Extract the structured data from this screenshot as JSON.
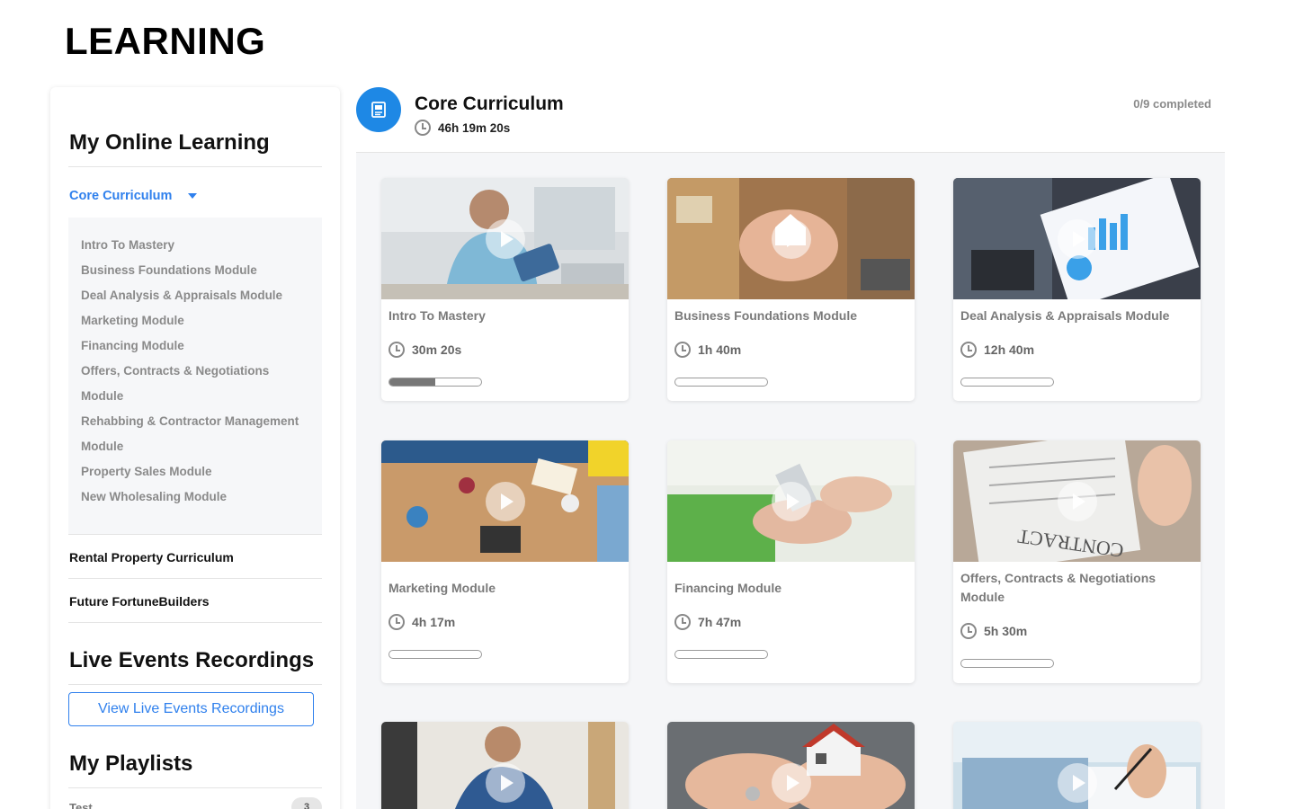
{
  "page": {
    "title": "LEARNING"
  },
  "sidebar": {
    "online_heading": "My Online Learning",
    "active_curriculum": "Core Curriculum",
    "modules": [
      "Intro To Mastery",
      "Business Foundations Module",
      "Deal Analysis & Appraisals Module",
      "Marketing Module",
      "Financing Module",
      "Offers, Contracts & Negotiations",
      "Module",
      "Rehabbing & Contractor Management",
      "Module",
      "Property Sales Module",
      "New Wholesaling Module"
    ],
    "curricula": [
      "Rental Property Curriculum",
      "Future FortuneBuilders"
    ],
    "live_heading": "Live Events Recordings",
    "live_button": "View Live Events Recordings",
    "playlists_heading": "My Playlists",
    "playlists": [
      {
        "name": "Test",
        "count": "3"
      }
    ]
  },
  "main": {
    "title": "Core Curriculum",
    "duration": "46h 19m 20s",
    "completed": "0/9 completed",
    "accent": "#1e88e5",
    "cards": [
      {
        "title": "Intro To Mastery",
        "duration": "30m 20s",
        "progress": 0.5,
        "image": "man-with-tablet"
      },
      {
        "title": "Business Foundations Module",
        "duration": "1h 40m",
        "progress": 0,
        "image": "hands-holding-house"
      },
      {
        "title": "Deal Analysis & Appraisals Module",
        "duration": "12h 40m",
        "progress": 0,
        "image": "charts-on-clipboard"
      },
      {
        "title": "Marketing Module",
        "duration": "4h 17m",
        "progress": 0,
        "image": "team-at-table"
      },
      {
        "title": "Financing Module",
        "duration": "7h 47m",
        "progress": 0,
        "image": "card-in-hand"
      },
      {
        "title": "Offers, Contracts & Negotiations Module",
        "duration": "5h 30m",
        "progress": 0,
        "image": "contract-signing"
      },
      {
        "title": "",
        "duration": "",
        "progress": 0,
        "image": "man-with-tools"
      },
      {
        "title": "",
        "duration": "",
        "progress": 0,
        "image": "house-and-keys"
      },
      {
        "title": "",
        "duration": "",
        "progress": 0,
        "image": "hand-signing"
      }
    ]
  }
}
